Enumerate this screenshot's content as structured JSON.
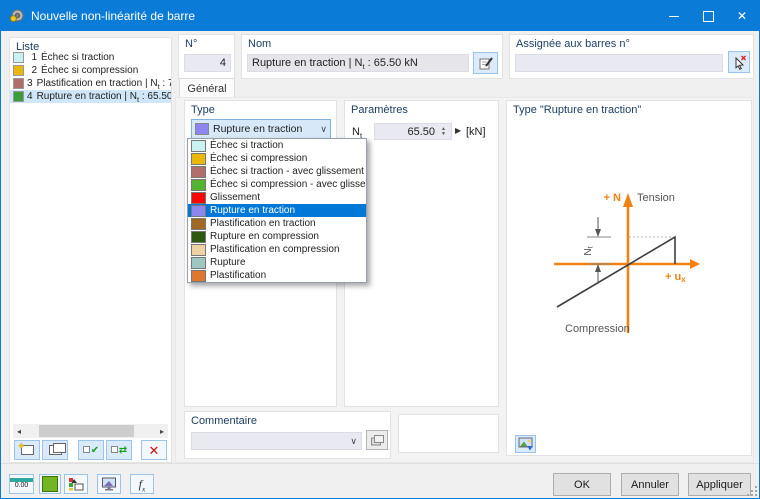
{
  "colors": {
    "titlebar": "#0b7bd8",
    "selection": "#0078d7",
    "accent_orange": "#ef8210",
    "caption_blue": "#1c3e63"
  },
  "window": {
    "title": "Nouvelle non-linéarité de barre"
  },
  "liste": {
    "caption": "Liste",
    "items": [
      {
        "num": "1",
        "color": "#c9f1f2",
        "pre": "Échec si traction"
      },
      {
        "num": "2",
        "color": "#eab70b",
        "pre": "Échec si compression"
      },
      {
        "num": "3",
        "color": "#b46e69",
        "pre": "Plastification en traction | N",
        "sub": "t",
        "post": " : 7"
      },
      {
        "num": "4",
        "color": "#3b9e3b",
        "pre": "Rupture en traction | N",
        "sub": "t",
        "post": " : 65.50"
      }
    ]
  },
  "header": {
    "num": {
      "caption": "N°",
      "value": "4"
    },
    "nom": {
      "caption": "Nom",
      "pre": "Rupture en traction | N",
      "sub": "t",
      "post": " : 65.50 kN"
    },
    "assignee": {
      "caption": "Assignée aux barres n°",
      "value": ""
    }
  },
  "tabs": {
    "general": "Général"
  },
  "type_group": {
    "caption": "Type",
    "combo": {
      "label": "Rupture en traction",
      "color": "#8d86ee"
    },
    "options": [
      {
        "label": "Échec si traction",
        "color": "#c9f1f2"
      },
      {
        "label": "Échec si compression",
        "color": "#eab70b"
      },
      {
        "label": "Échec si traction - avec glissement",
        "color": "#b46e69"
      },
      {
        "label": "Échec si compression - avec glissement",
        "color": "#55b332"
      },
      {
        "label": "Glissement",
        "color": "#f90606"
      },
      {
        "label": "Rupture en traction",
        "color": "#8d86ee"
      },
      {
        "label": "Plastification en traction",
        "color": "#a06a26"
      },
      {
        "label": "Rupture en compression",
        "color": "#2e5a0d"
      },
      {
        "label": "Plastification en compression",
        "color": "#eed2a4"
      },
      {
        "label": "Rupture",
        "color": "#9fc6c0"
      },
      {
        "label": "Plastification",
        "color": "#e0772f"
      }
    ]
  },
  "parametres": {
    "caption": "Paramètres",
    "symbol_pre": "N",
    "symbol_sub": "t",
    "value": "65.50",
    "unit": "[kN]"
  },
  "diagram_panel": {
    "caption": "Type \"Rupture en traction\"",
    "axis_n": "+ N",
    "tension": "Tension",
    "axis_ux_pre": "+ u",
    "axis_ux_sub": "x",
    "compression": "Compression",
    "dim_pre": "N",
    "dim_sub": "t"
  },
  "commentaire": {
    "caption": "Commentaire",
    "value": ""
  },
  "footer": {
    "ok": "OK",
    "annuler": "Annuler",
    "appliquer": "Appliquer",
    "units_icon_text": "0.00",
    "fx_pre": "f",
    "fx_sub": "x"
  }
}
